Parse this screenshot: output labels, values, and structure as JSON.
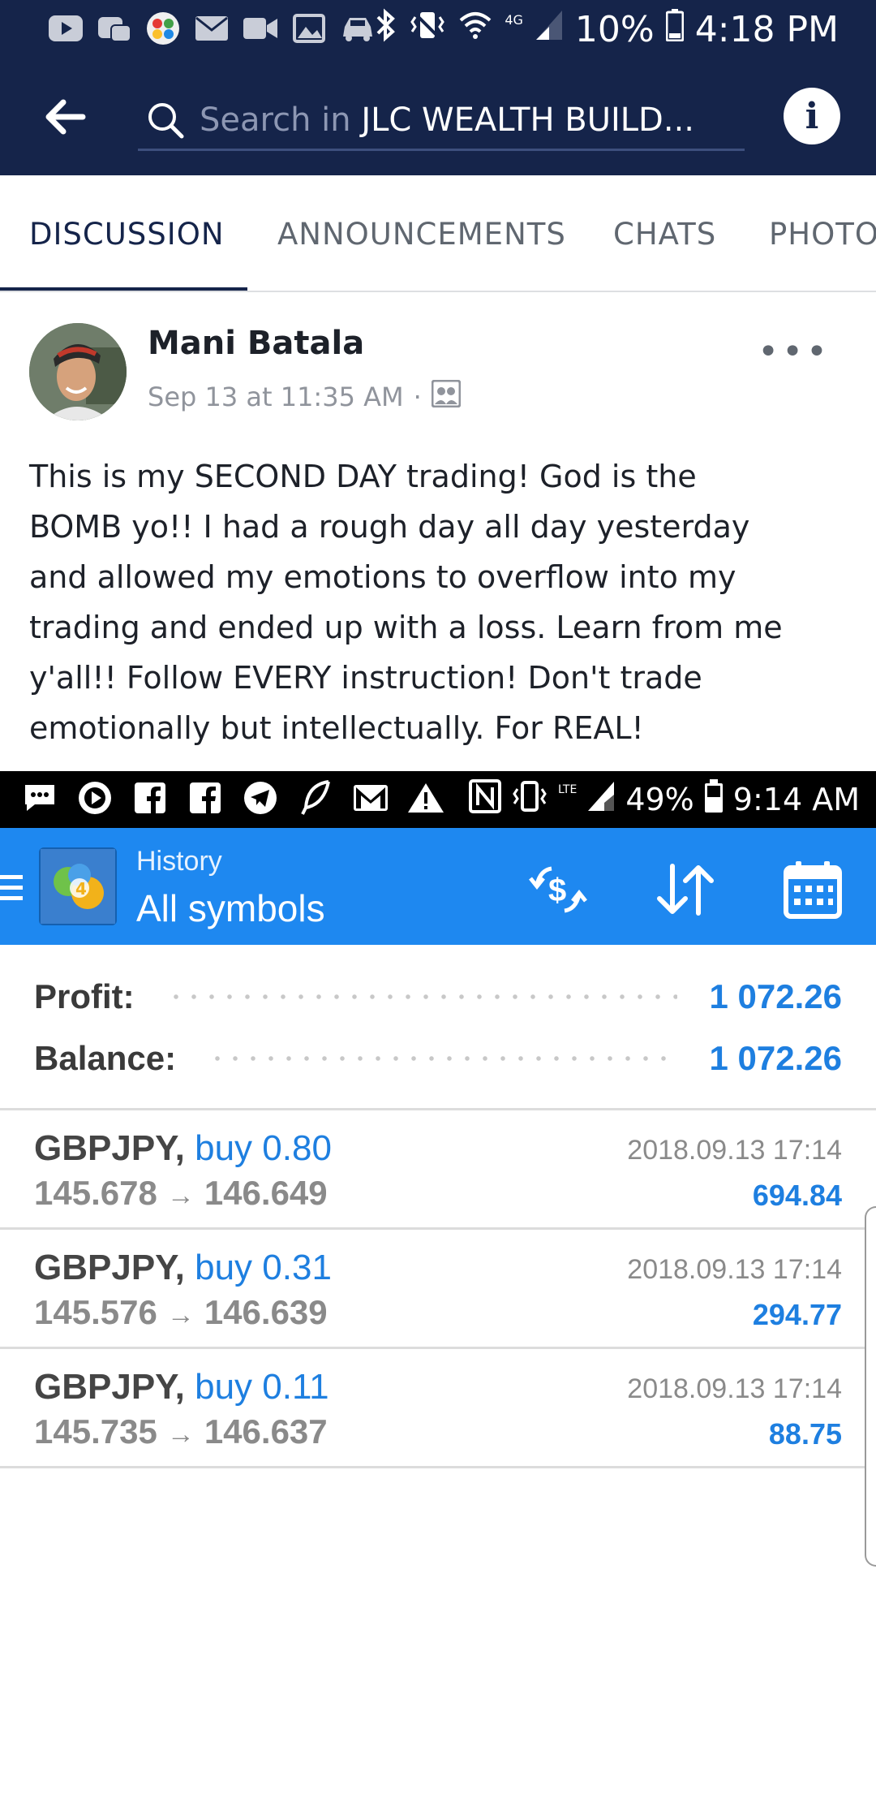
{
  "status_bar": {
    "battery": "10%",
    "time": "4:18 PM",
    "network": "4G",
    "icons": [
      "youtube-icon",
      "game-icon",
      "color-ball-icon",
      "mail-icon",
      "video-icon",
      "image-icon",
      "car-icon",
      "bluetooth-icon",
      "vibrate-icon",
      "wifi-icon",
      "signal-icon",
      "battery-icon"
    ]
  },
  "header": {
    "search_prefix": "Search in ",
    "search_group": "JLC WEALTH BUILD...",
    "info_label": "i"
  },
  "tabs": [
    {
      "label": "DISCUSSION",
      "active": true
    },
    {
      "label": "ANNOUNCEMENTS",
      "active": false
    },
    {
      "label": "CHATS",
      "active": false
    },
    {
      "label": "PHOTOS",
      "active": false
    }
  ],
  "post": {
    "author": "Mani Batala",
    "timestamp": "Sep 13 at 11:35 AM",
    "separator": "·",
    "more": "•••",
    "lines": [
      "This is my SECOND DAY trading! God is the",
      "BOMB yo!! I had a rough day all day yesterday",
      "and allowed my emotions to overflow into my",
      "trading and ended up with a loss. Learn from me",
      "y'all!! Follow EVERY instruction! Don't trade",
      "emotionally but intellectually. For REAL!"
    ]
  },
  "inner_status": {
    "lte": "LTE",
    "battery": "49%",
    "time": "9:14 AM",
    "icons": [
      "chat-icon",
      "play-icon",
      "facebook-icon",
      "facebook-icon",
      "telegram-icon",
      "feather-icon",
      "gmail-icon",
      "warning-icon",
      "nfc-icon",
      "vibrate-icon",
      "signal-icon",
      "battery-icon"
    ]
  },
  "trade_app": {
    "title": "History",
    "subtitle": "All symbols",
    "colors": {
      "toolbar": "#1e88f0",
      "value": "#1e7fe0"
    },
    "summary": [
      {
        "label": "Profit:",
        "value": "1 072.26"
      },
      {
        "label": "Balance:",
        "value": "1 072.26"
      }
    ],
    "deals": [
      {
        "symbol": "GBPJPY,",
        "action": "buy 0.80",
        "open": "145.678",
        "arrow": "→",
        "close": "146.649",
        "time": "2018.09.13 17:14",
        "profit": "694.84"
      },
      {
        "symbol": "GBPJPY,",
        "action": "buy 0.31",
        "open": "145.576",
        "arrow": "→",
        "close": "146.639",
        "time": "2018.09.13 17:14",
        "profit": "294.77"
      },
      {
        "symbol": "GBPJPY,",
        "action": "buy 0.11",
        "open": "145.735",
        "arrow": "→",
        "close": "146.637",
        "time": "2018.09.13 17:14",
        "profit": "88.75"
      }
    ]
  }
}
